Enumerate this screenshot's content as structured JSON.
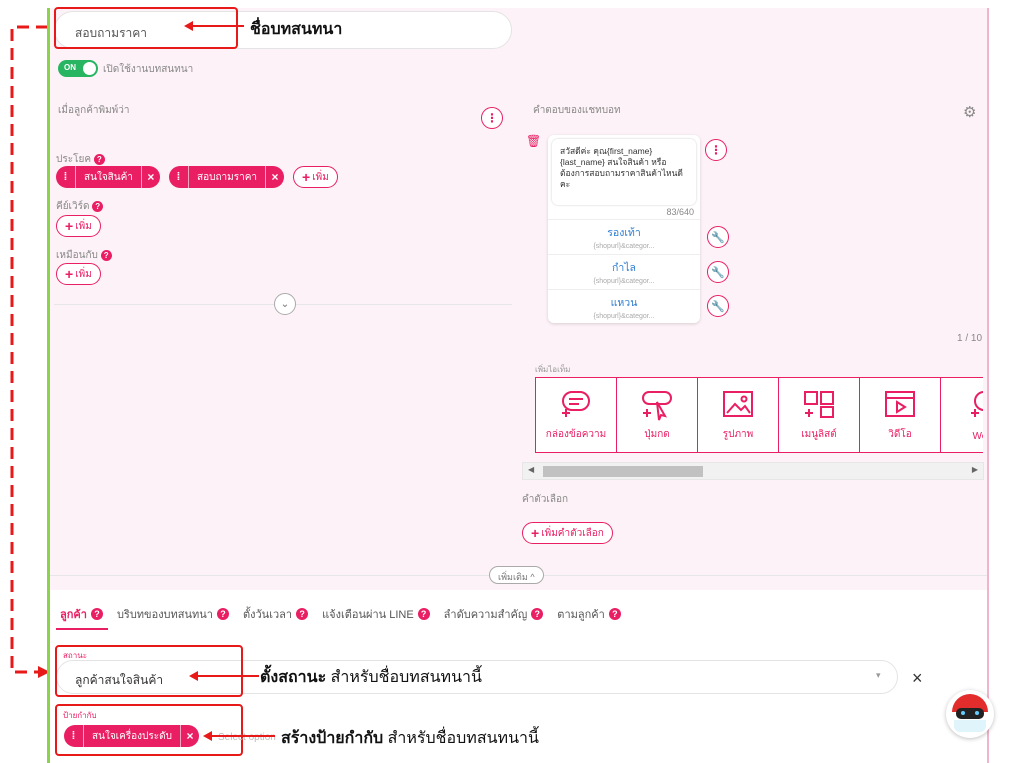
{
  "bot_name": {
    "value": "สอบถามราคา",
    "annotation": "ชื่อบทสนทนา"
  },
  "toggle": {
    "state_label": "ON",
    "label": "เปิดใช้งานบทสนทนา"
  },
  "customer_says": {
    "heading": "เมื่อลูกค้าพิมพ์ว่า",
    "sentence_label": "ประโยค",
    "sentence_chips": [
      "สนใจสินค้า",
      "สอบถามราคา"
    ],
    "keyword_label": "คีย์เวิร์ด",
    "similar_label": "เหมือนกับ",
    "add_label": "เพิ่ม"
  },
  "bot_reply": {
    "heading": "คำตอบของแชทบอท",
    "message": "สวัสดีค่ะ คุณ{first_name} {last_name} สนใจสินค้า หรือต้องการสอบถามราคาสินค้าไหนดีคะ",
    "char_count": "83/640",
    "quick_replies": [
      {
        "label": "รองเท้า",
        "payload": "{shopurl}&categor..."
      },
      {
        "label": "กำไล",
        "payload": "{shopurl}&categor..."
      },
      {
        "label": "แหวน",
        "payload": "{shopurl}&categor..."
      }
    ],
    "pagination": "1 / 10"
  },
  "add_item": {
    "heading": "เพิ่มไอเท็ม",
    "items": [
      {
        "label": "กล่องข้อความ",
        "icon": "message-box-icon"
      },
      {
        "label": "ปุ่มกด",
        "icon": "button-click-icon"
      },
      {
        "label": "รูปภาพ",
        "icon": "image-icon"
      },
      {
        "label": "เมนูลิสต์",
        "icon": "menu-list-icon"
      },
      {
        "label": "วิดีโอ",
        "icon": "video-icon"
      },
      {
        "label": "Wel",
        "icon": "web-icon"
      }
    ]
  },
  "options": {
    "heading": "คำตัวเลือก",
    "add_option_label": "เพิ่มคำตัวเลือก",
    "more_label": "เพิ่มเติม"
  },
  "tabs": [
    {
      "label": "ลูกค้า",
      "active": true
    },
    {
      "label": "บริบทของบทสนทนา",
      "active": false
    },
    {
      "label": "ตั้งวันเวลา",
      "active": false
    },
    {
      "label": "แจ้งเตือนผ่าน LINE",
      "active": false
    },
    {
      "label": "ลำดับความสำคัญ",
      "active": false
    },
    {
      "label": "ตามลูกค้า",
      "active": false
    }
  ],
  "status": {
    "label": "สถานะ",
    "value": "ลูกค้าสนใจสินค้า",
    "annotation_bold": "ตั้งสถานะ",
    "annotation_rest": " สำหรับชื่อบทสนทนานี้"
  },
  "tag": {
    "label": "ป้ายกำกับ",
    "chip": "สนใจเครื่องประดับ",
    "placeholder": "Select option",
    "annotation_bold": "สร้างป้ายกำกับ",
    "annotation_rest": " สำหรับชื่อบทสนทนานี้"
  },
  "colors": {
    "accent": "#e91e63",
    "annotation_red": "#e81919",
    "toggle_green": "#27b561",
    "panel_left_border": "#8bd34a"
  }
}
